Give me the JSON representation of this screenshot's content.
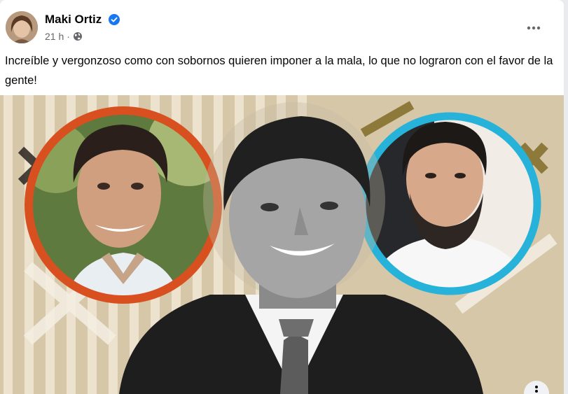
{
  "post": {
    "author": "Maki Ortiz",
    "time": "21 h",
    "text": "Increíble y vergonzoso como con sobornos quieren imponer a la mala, lo que no lograron con el favor de la gente!"
  },
  "icons": {
    "verified": "verified-badge-icon",
    "audience": "globe-icon",
    "more": "more-options-icon",
    "photo_menu": "photo-more-icon"
  },
  "colors": {
    "verified_blue": "#1877f2",
    "left_ring": "#d8501f",
    "right_ring": "#27b3d9",
    "background_tan": "#d6c7a8"
  }
}
